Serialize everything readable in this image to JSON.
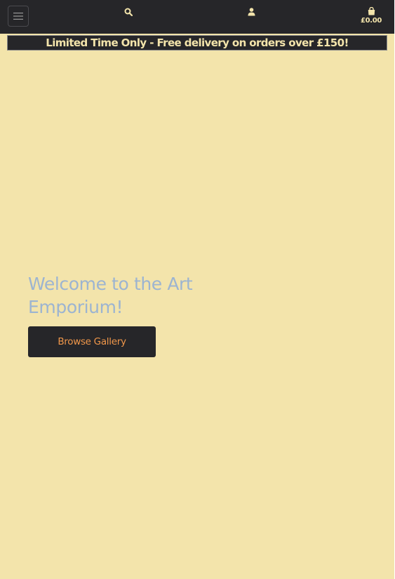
{
  "navbar": {
    "menu_icon": "hamburger-menu-icon",
    "search_icon": "search-icon",
    "account_icon": "user-icon",
    "cart_icon": "shopping-bag-icon",
    "cart_total": "£0.00"
  },
  "promo": {
    "text": "Limited Time Only - Free delivery on orders over £150!"
  },
  "hero": {
    "title": "Welcome to the Art Emporium!",
    "button_label": "Browse Gallery"
  },
  "colors": {
    "page_background": "#f3e4ab",
    "navbar_background": "#262629",
    "hero_title": "#9cb4d1",
    "button_text": "#f0974a"
  }
}
